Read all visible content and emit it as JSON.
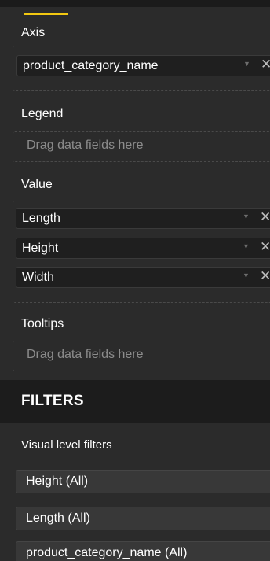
{
  "fields_pane": {
    "axis": {
      "label": "Axis",
      "fields": [
        "product_category_name"
      ]
    },
    "legend": {
      "label": "Legend",
      "placeholder": "Drag data fields here"
    },
    "value": {
      "label": "Value",
      "fields": [
        "Length",
        "Height",
        "Width"
      ]
    },
    "tooltips": {
      "label": "Tooltips",
      "placeholder": "Drag data fields here"
    }
  },
  "filters": {
    "title": "FILTERS",
    "visual_level_label": "Visual level filters",
    "items": [
      "Height (All)",
      "Length (All)",
      "product_category_name (All)"
    ]
  },
  "icons": {
    "dropdown": "chevron-down-icon",
    "remove": "close-icon"
  },
  "glyphs": {
    "chevron": "▼",
    "close": "✕"
  },
  "colors": {
    "accent": "#f2c811",
    "background": "#2b2b2b",
    "header": "#1c1c1c"
  }
}
